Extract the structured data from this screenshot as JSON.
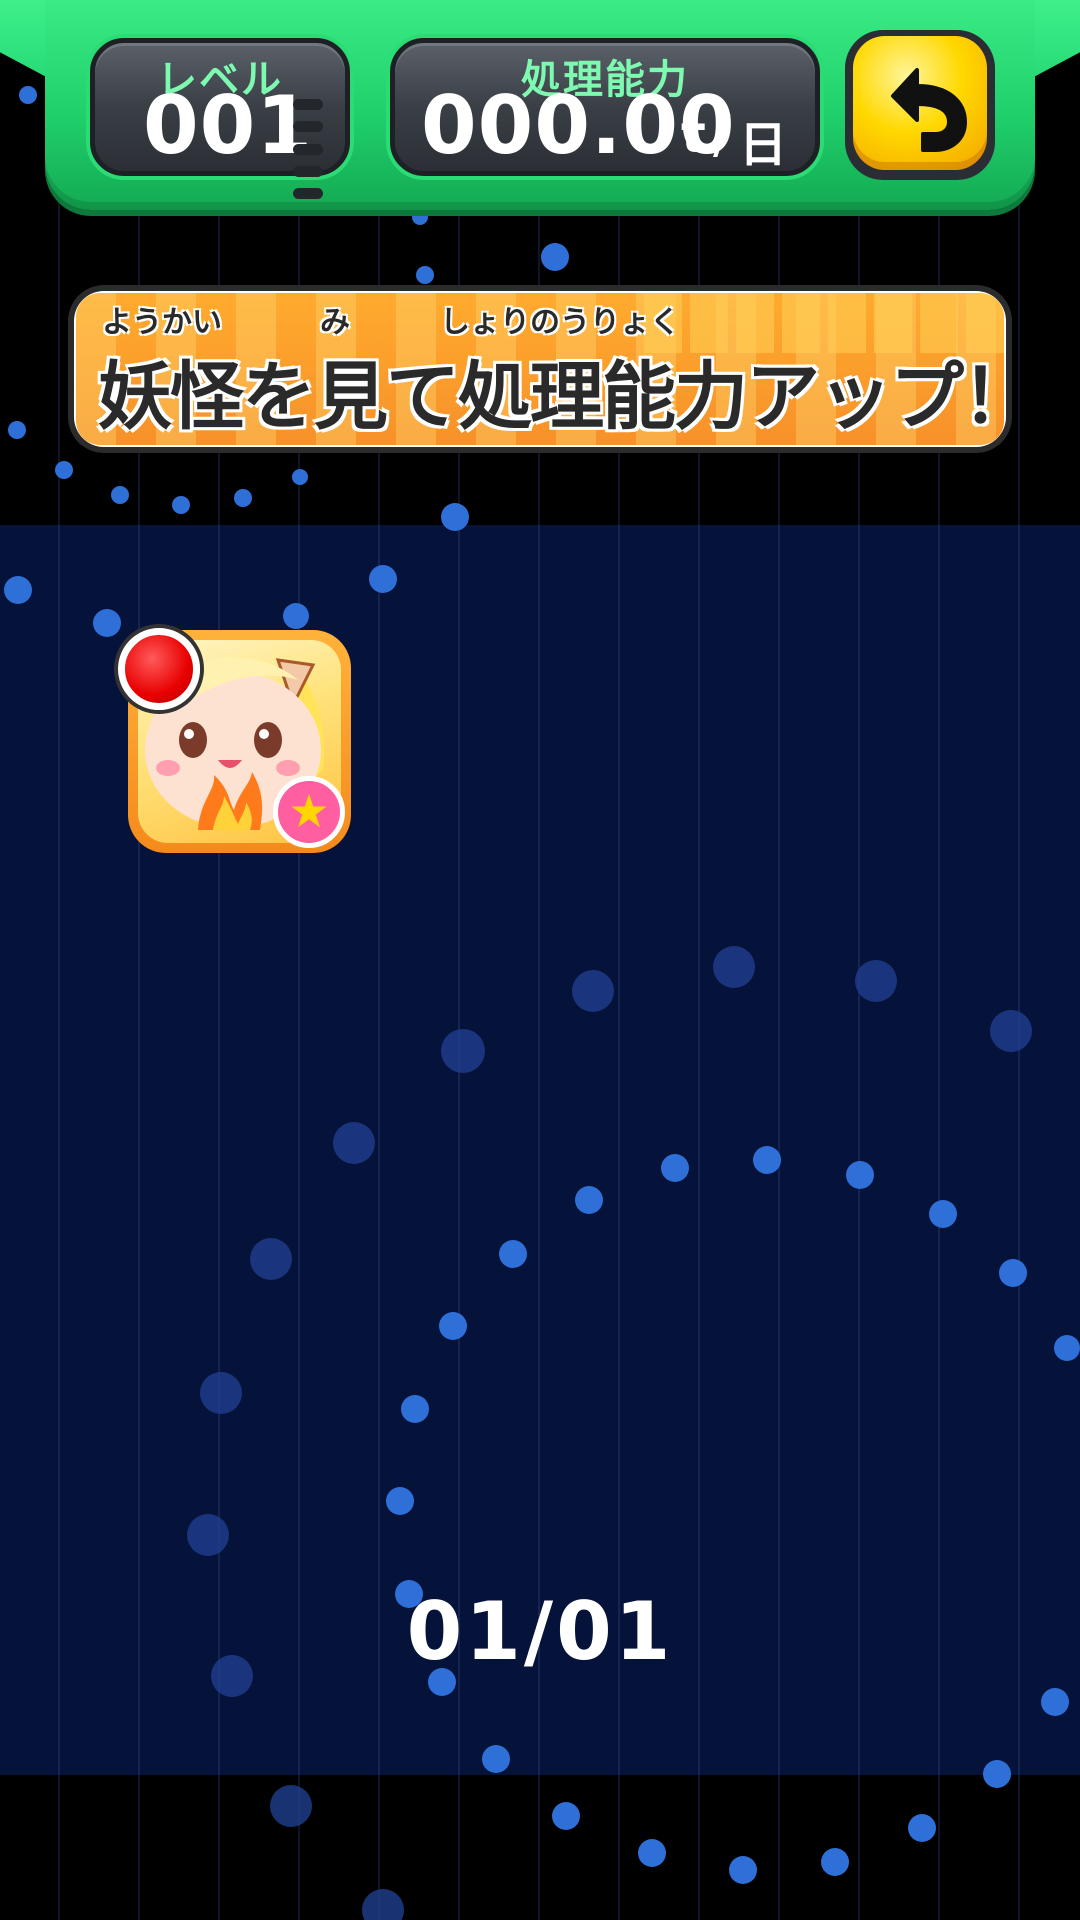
{
  "header": {
    "level_label": "レベル",
    "level_value": "001",
    "capacity_label": "処理能力",
    "capacity_value": "000.00",
    "capacity_unit_t": "t",
    "capacity_unit_sep": "/",
    "capacity_unit_day": "日",
    "back_icon": "back-arrow-icon"
  },
  "banner": {
    "ruby_youkai": "ようかい",
    "ruby_mi": "み",
    "ruby_shori": "しょりのうりょく",
    "text": "妖怪を見て処理能力アップ！"
  },
  "yokai_list": {
    "items": [
      {
        "name_hidden": "",
        "has_new_marker": true,
        "badge_icon": "star-icon"
      }
    ],
    "page_indicator": "01/01"
  },
  "colors": {
    "header_green": "#2fe07a",
    "panel_navy": "#05123a",
    "banner_orange": "#f7912a",
    "back_button_yellow": "#ffd800",
    "capacity_label_green": "#7dfab0"
  }
}
